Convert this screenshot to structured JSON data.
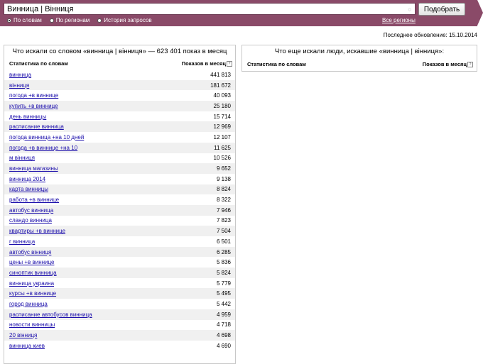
{
  "search": {
    "value": "Винница | Вінниця",
    "button": "Подобрать"
  },
  "modes": [
    {
      "label": "По словам",
      "checked": true
    },
    {
      "label": "По регионам",
      "checked": false
    },
    {
      "label": "История запросов",
      "checked": false
    }
  ],
  "all_regions": "Все регионы",
  "last_update": "Последнее обновление: 15.10.2014",
  "left_panel": {
    "title": "Что искали со словом «винница | вінниця» — 623 401 показ в месяц",
    "col_word": "Статистика по словам",
    "col_count": "Показов в месяц",
    "rows": [
      {
        "q": "винница",
        "n": "441 813"
      },
      {
        "q": "вінниця",
        "n": "181 672"
      },
      {
        "q": "погода +в виннице",
        "n": "40 093"
      },
      {
        "q": "купить +в виннице",
        "n": "25 180"
      },
      {
        "q": "день винницы",
        "n": "15 714"
      },
      {
        "q": "расписание винница",
        "n": "12 969"
      },
      {
        "q": "погода винница +на 10 дней",
        "n": "12 107"
      },
      {
        "q": "погода +в виннице +на 10",
        "n": "11 625"
      },
      {
        "q": "м вінниця",
        "n": "10 526"
      },
      {
        "q": "винница магазины",
        "n": "9 652"
      },
      {
        "q": "винница 2014",
        "n": "9 138"
      },
      {
        "q": "карта винницы",
        "n": "8 824"
      },
      {
        "q": "работа +в виннице",
        "n": "8 322"
      },
      {
        "q": "автобус винница",
        "n": "7 946"
      },
      {
        "q": "сландо винница",
        "n": "7 823"
      },
      {
        "q": "квартиры +в виннице",
        "n": "7 504"
      },
      {
        "q": "г винница",
        "n": "6 501"
      },
      {
        "q": "автобус вінниця",
        "n": "6 285"
      },
      {
        "q": "цены +в виннице",
        "n": "5 836"
      },
      {
        "q": "синоптик винница",
        "n": "5 824"
      },
      {
        "q": "винница украина",
        "n": "5 779"
      },
      {
        "q": "курсы +в виннице",
        "n": "5 495"
      },
      {
        "q": "город винница",
        "n": "5 442"
      },
      {
        "q": "расписание автобусов винница",
        "n": "4 959"
      },
      {
        "q": "новости винницы",
        "n": "4 718"
      },
      {
        "q": "20 вінниця",
        "n": "4 698"
      },
      {
        "q": "винница киев",
        "n": "4 690"
      }
    ]
  },
  "right_panel": {
    "title": "Что еще искали люди, искавшие «винница | вінниця»:",
    "col_word": "Статистика по словам",
    "col_count": "Показов в месяц"
  }
}
